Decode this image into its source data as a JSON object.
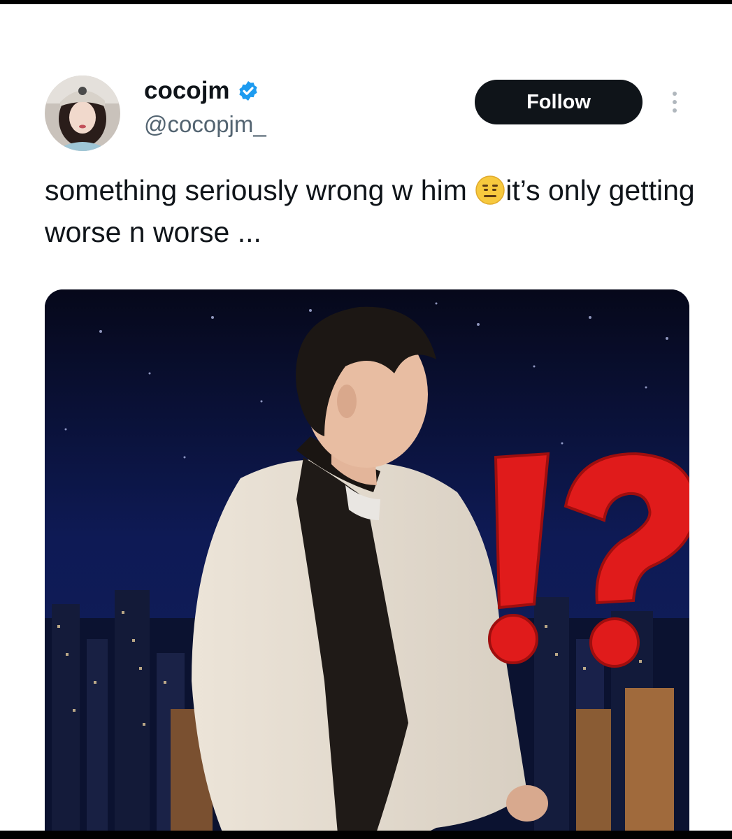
{
  "user": {
    "display_name": "cocojm",
    "handle": "@cocopjm_",
    "verified": true,
    "verified_color": "#1d9bf0"
  },
  "follow_button": {
    "label": "Follow"
  },
  "tweet": {
    "text_part1": "something seriously wrong w him ",
    "emoji": "neutral-face-emoji",
    "text_part2": "it’s only getting worse n worse ..."
  },
  "media": {
    "overlay_glyphs": "!?",
    "overlay_color": "#e01b1b"
  },
  "icons": {
    "more": "more-vertical-icon",
    "verified": "verified-badge-icon"
  }
}
